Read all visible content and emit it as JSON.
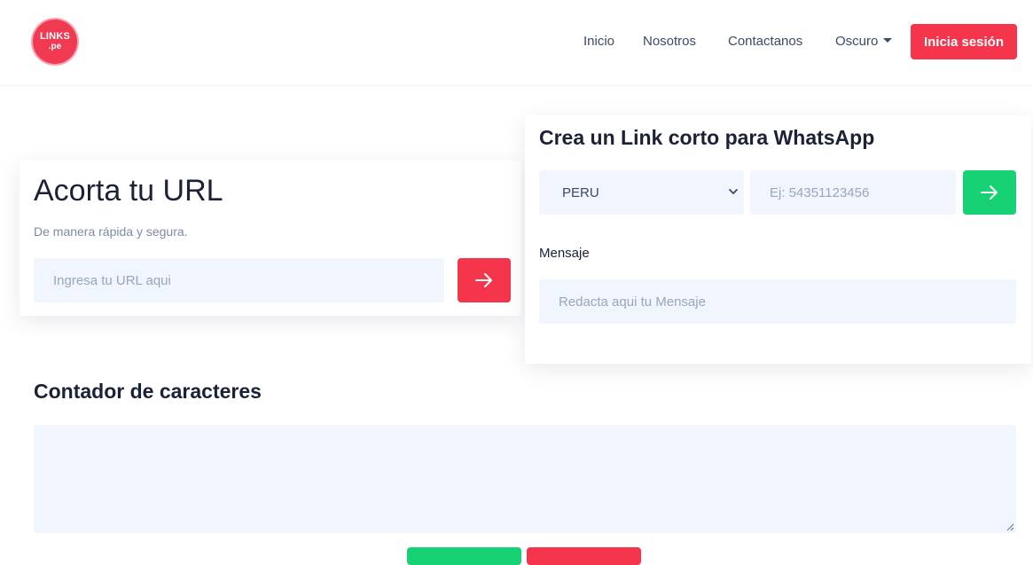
{
  "header": {
    "logo": {
      "line1": "LINKS",
      "line2": ".pe"
    },
    "nav": {
      "inicio": "Inicio",
      "nosotros": "Nosotros",
      "contactanos": "Contactanos",
      "theme": "Oscuro"
    },
    "login_label": "Inicia sesión"
  },
  "shortener": {
    "title": "Acorta tu URL",
    "subtitle": "De manera rápida y segura.",
    "url_placeholder": "Ingresa tu URL aqui"
  },
  "whatsapp": {
    "title": "Crea un Link corto para WhatsApp",
    "country_selected": "PERU",
    "phone_placeholder": "Ej: 54351123456",
    "message_label": "Mensaje",
    "message_placeholder": "Redacta aqui tu Mensaje"
  },
  "counter": {
    "title": "Contador de caracteres"
  },
  "colors": {
    "brand_red": "#f5354c",
    "whatsapp_green": "#17d175",
    "input_bg": "#f0f5fe",
    "nav_text": "#3c4a67"
  },
  "icons": {
    "submit": "arrow-right-icon",
    "select": "chevron-down-icon",
    "theme": "caret-down-icon"
  }
}
